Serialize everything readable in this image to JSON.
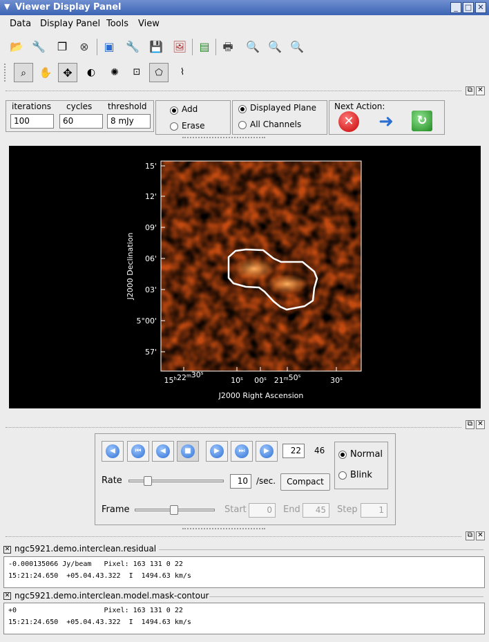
{
  "window": {
    "title": "Viewer Display Panel"
  },
  "menu": [
    "Data",
    "Display Panel",
    "Tools",
    "View"
  ],
  "toolbar_icons": [
    "open-folder-icon",
    "wrench-icon",
    "copy-panel-icon",
    "close-circle-icon",
    "new-panel-icon",
    "preferences-icon",
    "save-icon",
    "export-image-icon",
    "save-restore-icon",
    "print-icon",
    "zoom-fit-icon",
    "zoom-in-icon",
    "zoom-out-icon"
  ],
  "mouse_tools": [
    "zoom-tool-icon",
    "pan-tool-icon",
    "crosshair-tool-icon",
    "contrast-tool-icon",
    "colormap-tool-icon",
    "rectangle-region-icon",
    "polygon-region-icon",
    "polyline-tool-icon"
  ],
  "clean": {
    "iterations_label": "iterations",
    "iterations_value": "100",
    "cycles_label": "cycles",
    "cycles_value": "60",
    "threshold_label": "threshold",
    "threshold_value": "8 mJy",
    "add_label": "Add",
    "erase_label": "Erase",
    "displayed_plane_label": "Displayed Plane",
    "all_channels_label": "All Channels",
    "next_action_label": "Next Action:"
  },
  "plot": {
    "y_ticks": [
      "15'",
      "12'",
      "09'",
      "06'",
      "03'",
      "5°00'",
      "57'"
    ],
    "x_ticks": [
      {
        "main": "15",
        "h": "h",
        "main2": "22",
        "m": "m",
        "s": "30",
        "sec": "s"
      },
      {
        "s": "10",
        "sec": "s"
      },
      {
        "s": "00",
        "sec": "s"
      },
      {
        "main": "21",
        "m": "m",
        "s": "50",
        "sec": "s"
      },
      {
        "s": "30",
        "sec": "s"
      }
    ],
    "x_label": "J2000 Right Ascension",
    "y_label": "J2000 Declination"
  },
  "animator": {
    "frame_current": "22",
    "frame_total": "46",
    "normal_label": "Normal",
    "blink_label": "Blink",
    "rate_label": "Rate",
    "rate_value": "10",
    "rate_unit": "/sec.",
    "compact_label": "Compact",
    "frame_label": "Frame",
    "start_label": "Start",
    "start_value": "0",
    "end_label": "End",
    "end_value": "45",
    "step_label": "Step",
    "step_value": "1",
    "rate_level": 0.2,
    "frame_level": 0.49
  },
  "tracking": [
    {
      "title": "ngc5921.demo.interclean.residual",
      "line1": "-0.000135066 Jy/beam   Pixel: 163 131 0 22",
      "line2": "15:21:24.650  +05.04.43.322  I  1494.63 km/s"
    },
    {
      "title": "ngc5921.demo.interclean.model.mask-contour",
      "line1": "+0                     Pixel: 163 131 0 22",
      "line2": "15:21:24.650  +05.04.43.322  I  1494.63 km/s"
    }
  ]
}
